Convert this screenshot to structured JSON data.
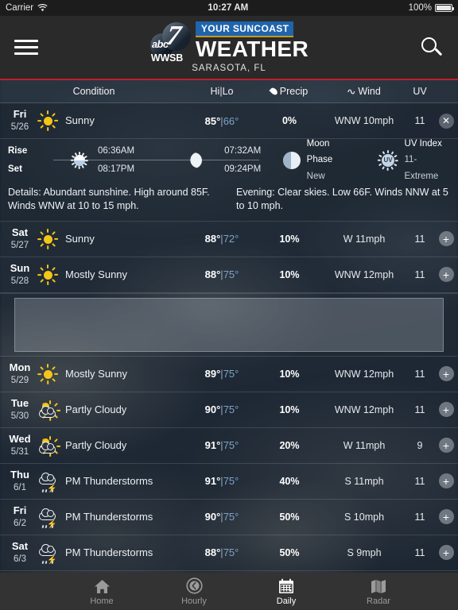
{
  "status_bar": {
    "carrier": "Carrier",
    "wifi_icon": "wifi-icon",
    "time": "10:27 AM",
    "battery": "100%"
  },
  "header": {
    "menu_icon": "hamburger-menu-icon",
    "search_icon": "search-icon",
    "logo": {
      "network": "abc",
      "channel": "7",
      "callsign": "WWSB",
      "banner": "YOUR SUNCOAST",
      "title": "WEATHER"
    },
    "location": "SARASOTA, FL",
    "accent_color": "#c0202a"
  },
  "columns": {
    "condition": "Condition",
    "temp": "Hi|Lo",
    "precip": "Precip",
    "precip_icon": "droplet-icon",
    "wind": "Wind",
    "wind_icon": "wind-icon",
    "uv": "UV"
  },
  "forecast": [
    {
      "day": "Fri",
      "date": "5/26",
      "condition": "Sunny",
      "icon": "sunny-icon",
      "hi": "85°",
      "lo": "66°",
      "precip": "0%",
      "wind": "WNW 10mph",
      "uv": "11",
      "action": "close",
      "expanded": true
    },
    {
      "day": "Sat",
      "date": "5/27",
      "condition": "Sunny",
      "icon": "sunny-icon",
      "hi": "88°",
      "lo": "72°",
      "precip": "10%",
      "wind": "W 11mph",
      "uv": "11",
      "action": "expand",
      "expanded": false
    },
    {
      "day": "Sun",
      "date": "5/28",
      "condition": "Mostly Sunny",
      "icon": "sunny-icon",
      "hi": "88°",
      "lo": "75°",
      "precip": "10%",
      "wind": "WNW 12mph",
      "uv": "11",
      "action": "expand",
      "expanded": false
    },
    {
      "day": "Mon",
      "date": "5/29",
      "condition": "Mostly Sunny",
      "icon": "sunny-icon",
      "hi": "89°",
      "lo": "75°",
      "precip": "10%",
      "wind": "WNW 12mph",
      "uv": "11",
      "action": "expand",
      "expanded": false
    },
    {
      "day": "Tue",
      "date": "5/30",
      "condition": "Partly Cloudy",
      "icon": "partly-cloudy-icon",
      "hi": "90°",
      "lo": "75°",
      "precip": "10%",
      "wind": "WNW 12mph",
      "uv": "11",
      "action": "expand",
      "expanded": false
    },
    {
      "day": "Wed",
      "date": "5/31",
      "condition": "Partly Cloudy",
      "icon": "partly-cloudy-icon",
      "hi": "91°",
      "lo": "75°",
      "precip": "20%",
      "wind": "W 11mph",
      "uv": "9",
      "action": "expand",
      "expanded": false
    },
    {
      "day": "Thu",
      "date": "6/1",
      "condition": "PM Thunderstorms",
      "icon": "thunderstorm-icon",
      "hi": "91°",
      "lo": "75°",
      "precip": "40%",
      "wind": "S 11mph",
      "uv": "11",
      "action": "expand",
      "expanded": false
    },
    {
      "day": "Fri",
      "date": "6/2",
      "condition": "PM Thunderstorms",
      "icon": "thunderstorm-icon",
      "hi": "90°",
      "lo": "75°",
      "precip": "50%",
      "wind": "S 10mph",
      "uv": "11",
      "action": "expand",
      "expanded": false
    },
    {
      "day": "Sat",
      "date": "6/3",
      "condition": "PM Thunderstorms",
      "icon": "thunderstorm-icon",
      "hi": "88°",
      "lo": "75°",
      "precip": "50%",
      "wind": "S 9mph",
      "uv": "11",
      "action": "expand",
      "expanded": false
    }
  ],
  "detail_panel": {
    "rise_label": "Rise",
    "set_label": "Set",
    "sun_rise": "06:36AM",
    "sun_set": "08:17PM",
    "moon_rise": "07:32AM",
    "moon_set": "09:24PM",
    "moon_phase_label": "Moon Phase",
    "moon_phase_value": "New",
    "uv_index_label": "UV Index",
    "uv_index_value": "11-Extreme",
    "details_day": "Details: Abundant sunshine. High around 85F. Winds WNW at 10 to 15 mph.",
    "details_evening": "Evening: Clear skies. Low 66F. Winds NNW at 5 to 10 mph."
  },
  "ad_slot": {
    "label": ""
  },
  "tabs": [
    {
      "label": "Home",
      "icon": "home-icon",
      "active": false
    },
    {
      "label": "Hourly",
      "icon": "clock-icon",
      "active": false
    },
    {
      "label": "Daily",
      "icon": "calendar-icon",
      "active": true
    },
    {
      "label": "Radar",
      "icon": "map-icon",
      "active": false
    }
  ]
}
